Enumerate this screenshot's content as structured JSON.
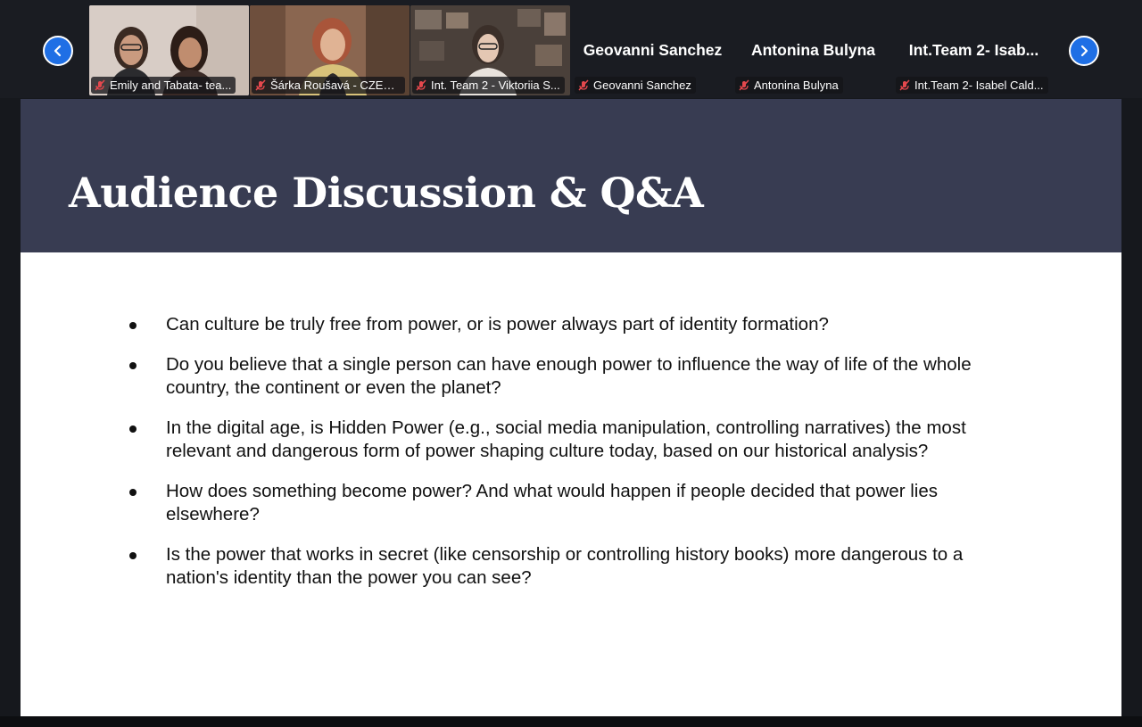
{
  "participants": [
    {
      "label": "Emily and Tabata- tea...",
      "type": "video"
    },
    {
      "label": "Šárka Roušavá - CZEC...",
      "type": "video"
    },
    {
      "label": "Int. Team 2 - Viktoriia S...",
      "type": "video"
    },
    {
      "label": "Geovanni Sanchez",
      "display_name": "Geovanni Sanchez",
      "type": "name"
    },
    {
      "label": "Antonina Bulyna",
      "display_name": "Antonina Bulyna",
      "type": "name"
    },
    {
      "label": "Int.Team 2- Isabel Cald...",
      "display_name": "Int.Team 2- Isab...",
      "type": "name"
    }
  ],
  "icons": {
    "prev": "chevron-left-icon",
    "next": "chevron-right-icon",
    "mic": "mic-muted-icon"
  },
  "colors": {
    "nav_button": "#1f6fe5",
    "slide_header": "#383c52",
    "mic_muted": "#e5484d"
  },
  "slide": {
    "title": "Audience Discussion & Q&A",
    "bullets": [
      "Can culture be truly free from power, or is power always part of identity formation?",
      "Do you believe that a single person can have enough power to influence the way of life of the whole country, the continent or even the planet?",
      "In the digital age, is Hidden Power (e.g., social media manipulation, controlling narratives) the most relevant and dangerous form of power shaping culture today, based on our historical analysis?",
      "How does something become power? And what would happen if people decided that power lies elsewhere?",
      "Is the power that works in secret (like censorship or controlling history books) more dangerous to a nation's identity than the power you can see?"
    ]
  }
}
